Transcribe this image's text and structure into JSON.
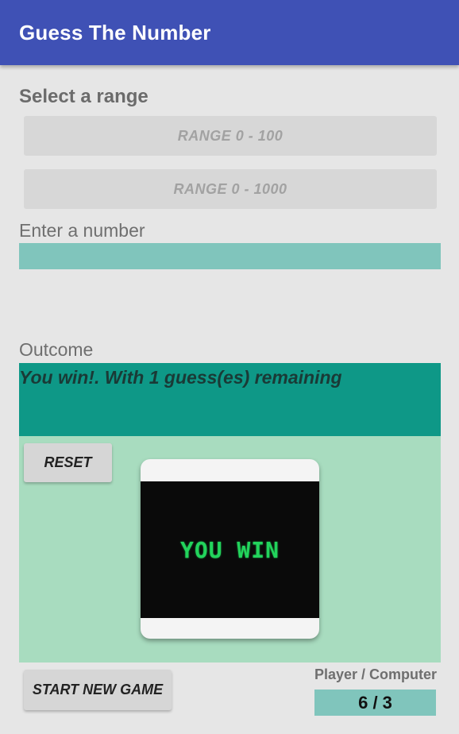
{
  "app_bar": {
    "title": "Guess The Number",
    "color": "#3f51b5"
  },
  "range": {
    "heading": "Select a range",
    "buttons": [
      {
        "label": "RANGE 0 - 100"
      },
      {
        "label": "RANGE 0 - 1000"
      }
    ]
  },
  "input": {
    "label": "Enter a number",
    "value": "",
    "color": "#80c5bc"
  },
  "outcome": {
    "label": "Outcome",
    "message": "You win!. With 1 guess(es) remaining",
    "color": "#0e9887"
  },
  "result_panel": {
    "reset_label": "RESET",
    "image_text": "YOU WIN",
    "color": "#a8dcbf"
  },
  "footer": {
    "new_game_label": "START NEW GAME",
    "score_label": "Player / Computer",
    "score_value": "6 / 3"
  }
}
